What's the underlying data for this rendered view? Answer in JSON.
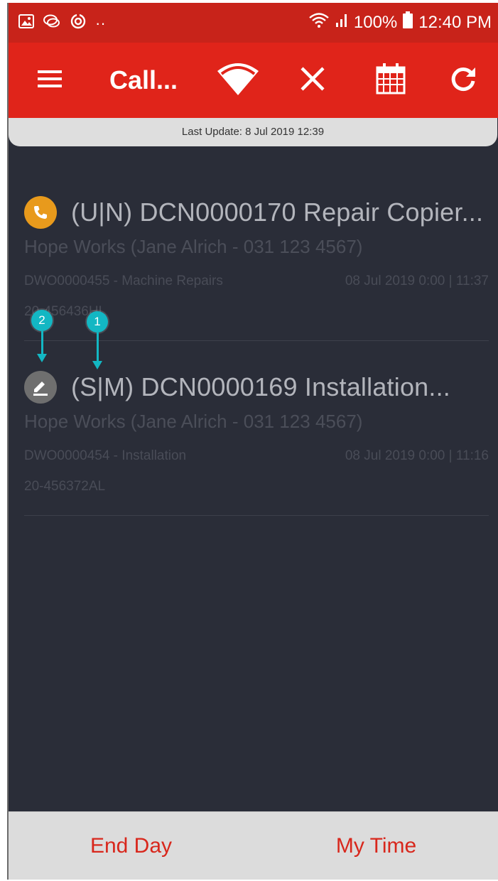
{
  "status_bar": {
    "left_icons": [
      "image-icon",
      "chat-bubbles-icon",
      "sync-icon",
      "more-dots-icon"
    ],
    "battery_percent": "100%",
    "time": "12:40 PM",
    "colors": {
      "background": "#c8231a"
    }
  },
  "app_bar": {
    "title": "Call...",
    "icons": [
      "menu-icon",
      "wifi-icon",
      "close-icon",
      "calendar-icon",
      "refresh-icon"
    ],
    "colors": {
      "background": "#e0241a"
    }
  },
  "last_update": "Last Update: 8 Jul 2019 12:39",
  "calls": [
    {
      "icon": "phone-icon",
      "icon_color": "#e89a1c",
      "title": "(U|N) DCN0000170 Repair Copier...",
      "customer": "Hope Works (Jane Alrich - 031 123 4567)",
      "work_order": "DWO0000455 - Machine Repairs",
      "date": "08 Jul 2019 0:00 | 11:37",
      "serial": "20-456436HL"
    },
    {
      "icon": "edit-icon",
      "icon_color": "#6f6f6f",
      "title": "(S|M) DCN0000169 Installation...",
      "customer": "Hope Works (Jane Alrich - 031 123 4567)",
      "work_order": "DWO0000454 - Installation",
      "date": "08 Jul 2019 0:00 | 11:16",
      "serial": "20-456372AL"
    }
  ],
  "annotations": [
    {
      "label": "1"
    },
    {
      "label": "2"
    }
  ],
  "bottom_bar": {
    "end_day": "End Day",
    "my_time": "My Time"
  }
}
